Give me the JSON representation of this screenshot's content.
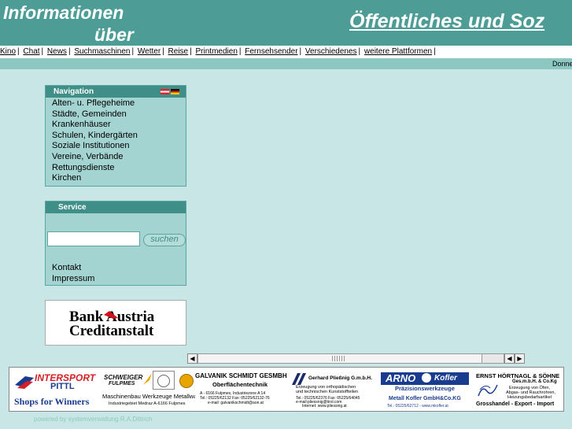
{
  "header": {
    "left_line1": "Informationen",
    "left_line2": "über",
    "right_title": "Öffentliches und Soz"
  },
  "topnav": {
    "items": [
      "Kino",
      "Chat",
      "News",
      "Suchmaschinen",
      "Wetter",
      "Reise",
      "Printmedien",
      "Fernsehsender",
      "Verschiedenes",
      "weitere Plattformen"
    ],
    "separator": "|"
  },
  "ticker": {
    "text": "Donne"
  },
  "navigation": {
    "title": "Navigation",
    "items": [
      "Alten- u. Pflegeheime",
      "Städte, Gemeinden",
      "Krankenhäuser",
      "Schulen, Kindergärten",
      "Soziale Institutionen",
      "Vereine, Verbände",
      "Rettungsdienste",
      "Kirchen"
    ]
  },
  "service": {
    "title": "Service",
    "search_value": "",
    "search_button": "suchen",
    "links": [
      "Kontakt",
      "Impressum"
    ]
  },
  "bank": {
    "line1": "Bank Austria",
    "line2": "Creditanstalt"
  },
  "scrollbar": {
    "left_arrow": "◀",
    "right_arrow": "▶"
  },
  "ads": {
    "intersport": {
      "name": "INTERSPORT",
      "sub": "PITTL",
      "slogan": "Shops for Winners"
    },
    "schweiger": {
      "name": "SCHWEIGER",
      "sub": "FULPMES",
      "desc": "Maschinenbau Werkzeuge Metallwaren",
      "addr": "Industriegebiet Medraz A-6166 Fulpmes"
    },
    "galvanik": {
      "title": "GALVANIK SCHMIDT GESMBH",
      "sub": "Oberflächentechnik",
      "addr": "A - 6166 Fulpmes, Industriezone A 14",
      "tel": "Tel.: 05225/62132    Fax: 05225/62132-76",
      "mail": "e-mail: galvanikschmidt@aon.at"
    },
    "pliessnig": {
      "title": "Gerhard Pließnig G.m.b.H.",
      "l1": "Erzeugung von orthopädischen",
      "l2": "und technischen Kunststoffteilen",
      "l3": "Tel.: 05225/62376 Fax: 05225/64045",
      "l4": "e-mail:pliessnig@tirol.com",
      "l5": "Internet: www.pliessnig.at"
    },
    "arno": {
      "brand1": "ARNO",
      "brand2": "Kofler",
      "sub": "Präzisionswerkzeuge",
      "company": "Metall Kofler GmbH&Co.KG",
      "tel": "Tel.: 05225/62712 - www.mkofler.at"
    },
    "hoertnagl": {
      "title": "ERNST HÖRTNAGL & SÖHNE",
      "sub": "Ges.m.b.H. & Co.Kg",
      "l1": "Erzeugung von Öfen,",
      "l2": "Abgas- und Rauchrohren,",
      "l3": "Heizungsbedarfsartikel",
      "bottom": "Grosshandel - Export - Import"
    }
  },
  "footer": {
    "text": "powered by systemverwaltung R.A.Dittrich"
  },
  "colors": {
    "background": "#c8e6e6",
    "header": "#4d9d96",
    "box_header": "#3f8f88",
    "box_body": "#a3d4d1",
    "ticker": "#8cc7c2"
  }
}
